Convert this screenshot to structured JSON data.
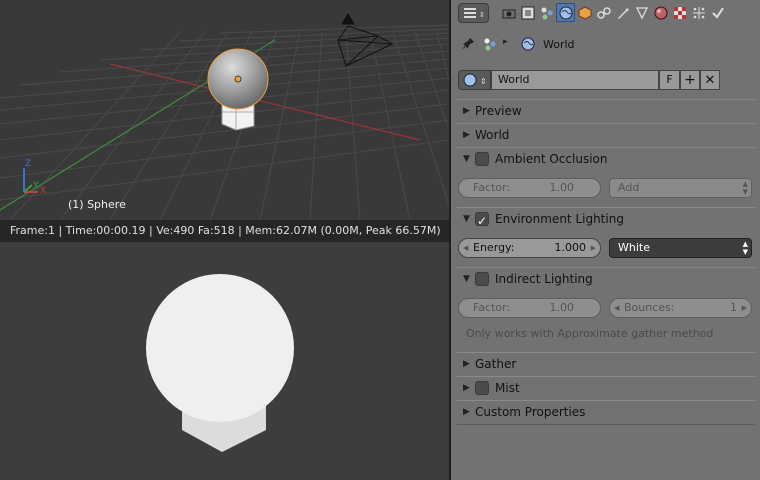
{
  "viewport": {
    "object_label": "(1) Sphere",
    "axis_x": "X",
    "axis_y": "Y",
    "axis_z": "Z"
  },
  "status_bar": {
    "text": "Frame:1 | Time:00:00.19 | Ve:490 Fa:518 | Mem:62.07M (0.00M, Peak 66.57M)"
  },
  "properties": {
    "breadcrumb": {
      "world": "World"
    },
    "datablock": {
      "name": "World",
      "fake_user": "F"
    },
    "panels": {
      "preview": "Preview",
      "world": "World",
      "ambient_occlusion": "Ambient Occlusion",
      "environment_lighting": "Environment Lighting",
      "indirect_lighting": "Indirect Lighting",
      "gather": "Gather",
      "mist": "Mist",
      "custom_properties": "Custom Properties"
    },
    "ao": {
      "factor_label": "Factor:",
      "factor_value": "1.00",
      "blend": "Add"
    },
    "env": {
      "energy_label": "Energy:",
      "energy_value": "1.000",
      "color": "White"
    },
    "indirect": {
      "factor_label": "Factor:",
      "factor_value": "1.00",
      "bounces_label": "Bounces:",
      "bounces_value": "1",
      "note": "Only works with Approximate gather method"
    }
  },
  "colors": {
    "panel_bg": "#727272",
    "viewport_bg": "#393939",
    "active_tab": "#4b7ab2",
    "grid_x_axis": "#a33b3b",
    "grid_y_axis": "#3b8a3b"
  },
  "icons": {
    "tabs": [
      "render-icon",
      "render-layers-icon",
      "scene-icon",
      "world-icon",
      "object-icon",
      "constraints-icon",
      "modifiers-icon",
      "data-icon",
      "material-icon",
      "texture-icon",
      "particles-icon",
      "physics-icon"
    ]
  }
}
